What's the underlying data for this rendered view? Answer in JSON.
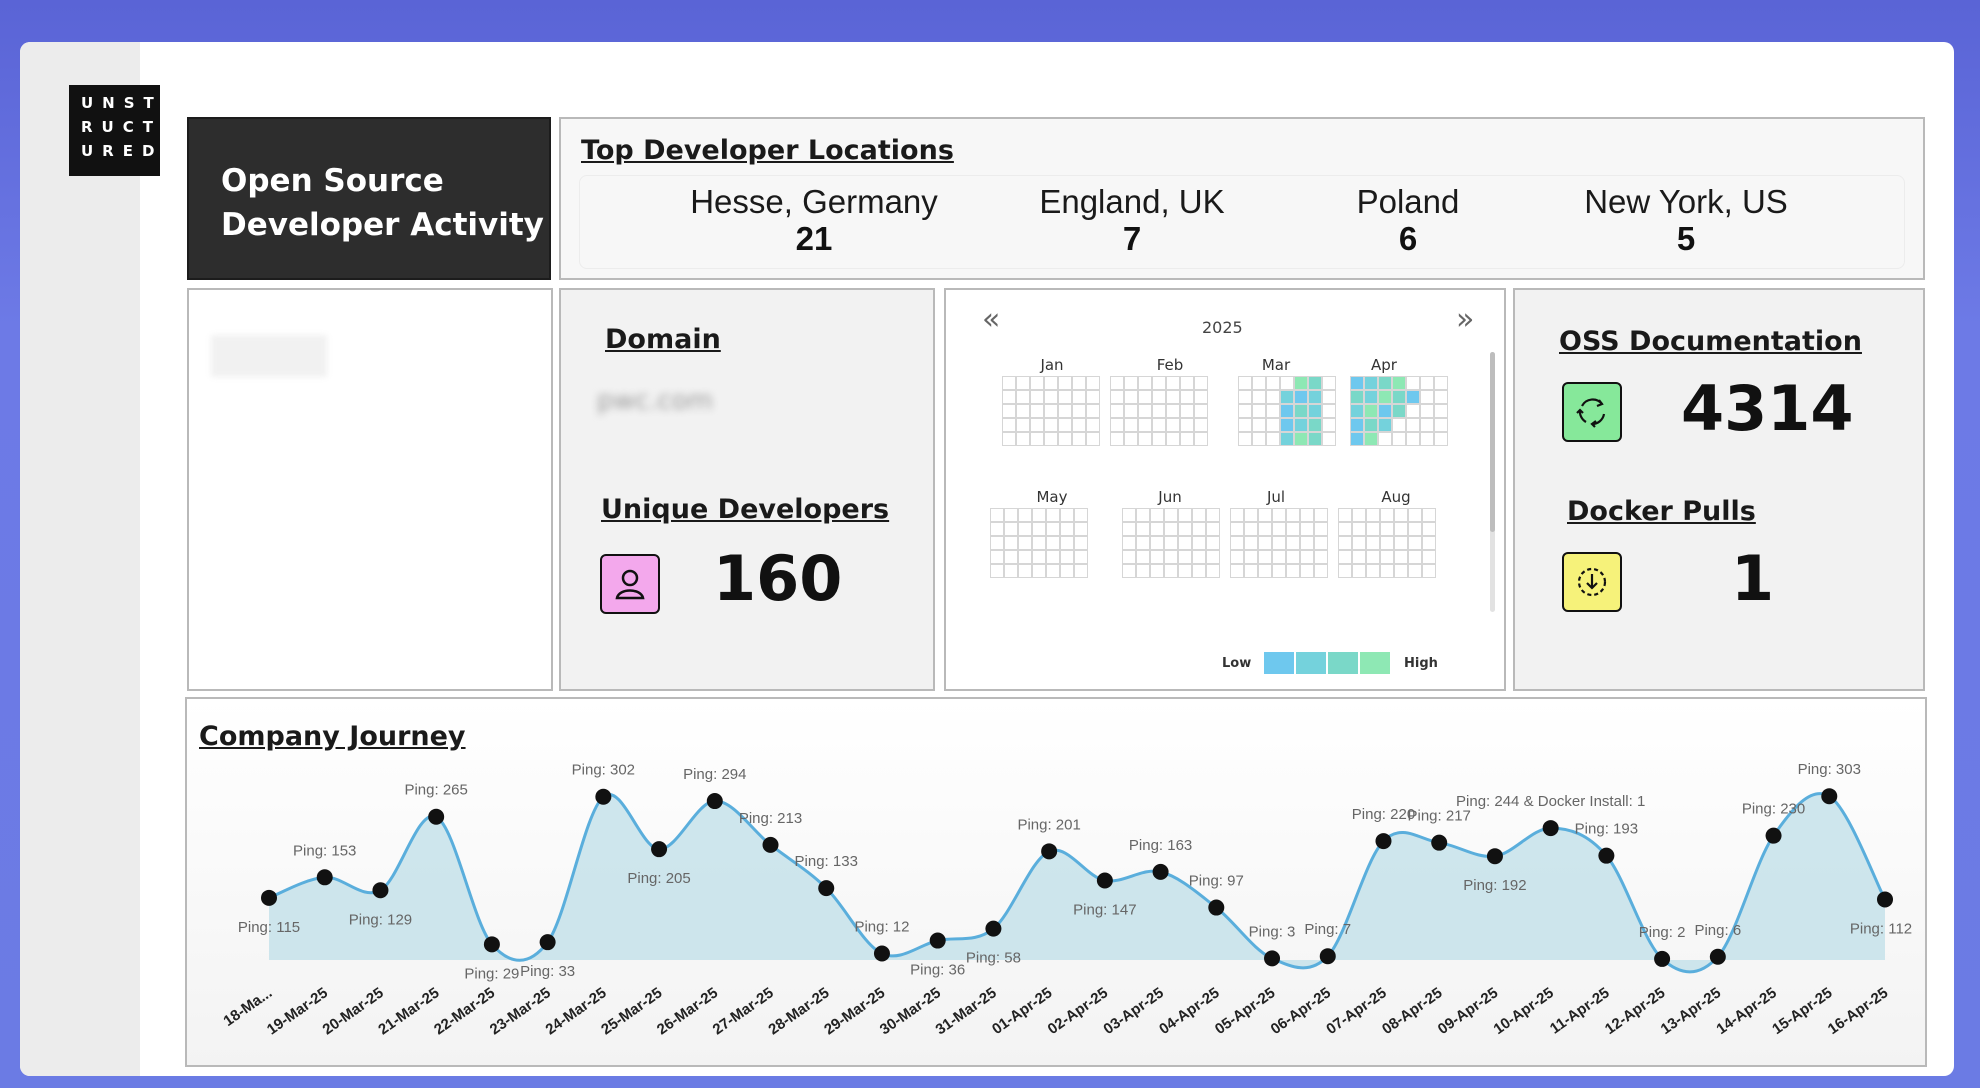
{
  "logo": {
    "lines": [
      "UNST",
      "RUCT",
      "URED"
    ]
  },
  "title": {
    "line1": "Open Source",
    "line2": "Developer Activity"
  },
  "locations": {
    "heading": "Top Developer Locations",
    "items": [
      {
        "name": "Hesse, Germany",
        "count": "21"
      },
      {
        "name": "England, UK",
        "count": "7"
      },
      {
        "name": "Poland",
        "count": "6"
      },
      {
        "name": "New York, US",
        "count": "5"
      }
    ]
  },
  "domain": {
    "heading": "Domain",
    "value": "pwc.com"
  },
  "developers": {
    "heading": "Unique Developers",
    "value": "160",
    "icon": "user-icon"
  },
  "calendar": {
    "year": "2025",
    "prev": "«",
    "next": "»",
    "months_row1": [
      "Jan",
      "Feb",
      "Mar",
      "Apr"
    ],
    "months_row2": [
      "May",
      "Jun",
      "Jul",
      "Aug"
    ],
    "legend_low": "Low",
    "legend_high": "High",
    "colors": [
      "#6ec8ee",
      "#74d2dc",
      "#7ad8c8",
      "#8ee8b4"
    ]
  },
  "oss": {
    "heading": "OSS Documentation",
    "value": "4314",
    "icon": "refresh-cycle-icon",
    "icon_bg": "#86e89a"
  },
  "docker": {
    "heading": "Docker Pulls",
    "value": "1",
    "icon": "download-icon",
    "icon_bg": "#f6f27a"
  },
  "journey": {
    "heading": "Company Journey",
    "chart_data": {
      "type": "area",
      "x": [
        "18-Ma...",
        "19-Mar-25",
        "20-Mar-25",
        "21-Mar-25",
        "22-Mar-25",
        "23-Mar-25",
        "24-Mar-25",
        "25-Mar-25",
        "26-Mar-25",
        "27-Mar-25",
        "28-Mar-25",
        "29-Mar-25",
        "30-Mar-25",
        "31-Mar-25",
        "01-Apr-25",
        "02-Apr-25",
        "03-Apr-25",
        "04-Apr-25",
        "05-Apr-25",
        "06-Apr-25",
        "07-Apr-25",
        "08-Apr-25",
        "09-Apr-25",
        "10-Apr-25",
        "11-Apr-25",
        "12-Apr-25",
        "13-Apr-25",
        "14-Apr-25",
        "15-Apr-25",
        "16-Apr-25"
      ],
      "values": [
        115,
        153,
        129,
        265,
        29,
        33,
        302,
        205,
        294,
        213,
        133,
        12,
        36,
        58,
        201,
        147,
        163,
        97,
        3,
        7,
        220,
        217,
        192,
        244,
        193,
        2,
        6,
        230,
        303,
        112
      ],
      "labels": [
        "Ping: 115",
        "Ping: 153",
        "Ping: 129",
        "Ping: 265",
        "Ping: 29",
        "Ping: 33",
        "Ping: 302",
        "Ping: 205",
        "Ping: 294",
        "Ping: 213",
        "Ping: 133",
        "Ping: 12",
        "Ping: 36",
        "Ping: 58",
        "Ping: 201",
        "Ping: 147",
        "Ping: 163",
        "Ping: 97",
        "Ping: 3",
        "Ping: 7",
        "Ping: 220",
        "Ping: 217",
        "Ping: 192",
        "Ping: 244 & Docker Install: 1",
        "Ping: 193",
        "Ping: 2",
        "Ping: 6",
        "Ping: 230",
        "Ping: 303",
        "Ping: 112"
      ],
      "ylim": [
        0,
        320
      ],
      "line_color": "#5aaedc",
      "fill_color": "#c6e2ea"
    }
  }
}
